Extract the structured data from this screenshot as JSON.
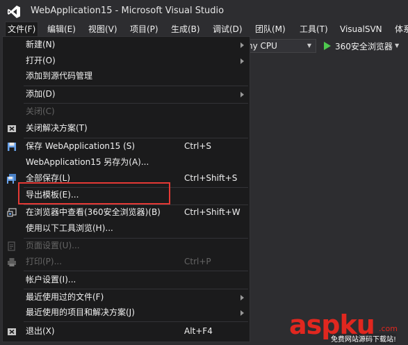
{
  "window": {
    "title": "WebApplication15 - Microsoft Visual Studio"
  },
  "menubar": {
    "items": [
      "文件(F)",
      "编辑(E)",
      "视图(V)",
      "项目(P)",
      "生成(B)",
      "调试(D)",
      "团队(M)",
      "工具(T)",
      "VisualSVN",
      "体系"
    ]
  },
  "toolbar": {
    "cpu": "ny CPU",
    "browser": "360安全浏览器"
  },
  "file_menu": {
    "items": [
      {
        "label": "新建(N)",
        "shortcut": "",
        "submenu": true,
        "disabled": false,
        "icon": ""
      },
      {
        "label": "打开(O)",
        "shortcut": "",
        "submenu": true,
        "disabled": false,
        "icon": ""
      },
      {
        "label": "添加到源代码管理",
        "shortcut": "",
        "submenu": false,
        "disabled": false,
        "icon": ""
      },
      {
        "label": "添加(D)",
        "shortcut": "",
        "submenu": true,
        "disabled": false,
        "icon": ""
      },
      {
        "label": "关闭(C)",
        "shortcut": "",
        "submenu": false,
        "disabled": true,
        "icon": ""
      },
      {
        "label": "关闭解决方案(T)",
        "shortcut": "",
        "submenu": false,
        "disabled": false,
        "icon": "close-solution-icon"
      },
      {
        "label": "保存 WebApplication15 (S)",
        "shortcut": "Ctrl+S",
        "submenu": false,
        "disabled": false,
        "icon": "save-icon"
      },
      {
        "label": "WebApplication15 另存为(A)...",
        "shortcut": "",
        "submenu": false,
        "disabled": false,
        "icon": ""
      },
      {
        "label": "全部保存(L)",
        "shortcut": "Ctrl+Shift+S",
        "submenu": false,
        "disabled": false,
        "icon": "save-all-icon"
      },
      {
        "label": "导出模板(E)...",
        "shortcut": "",
        "submenu": false,
        "disabled": false,
        "icon": ""
      },
      {
        "label": "在浏览器中查看(360安全浏览器)(B)",
        "shortcut": "Ctrl+Shift+W",
        "submenu": false,
        "disabled": false,
        "icon": "view-in-browser-icon"
      },
      {
        "label": "使用以下工具浏览(H)...",
        "shortcut": "",
        "submenu": false,
        "disabled": false,
        "icon": ""
      },
      {
        "label": "页面设置(U)...",
        "shortcut": "",
        "submenu": false,
        "disabled": true,
        "icon": "page-setup-icon"
      },
      {
        "label": "打印(P)...",
        "shortcut": "Ctrl+P",
        "submenu": false,
        "disabled": true,
        "icon": "print-icon"
      },
      {
        "label": "帐户设置(I)...",
        "shortcut": "",
        "submenu": false,
        "disabled": false,
        "icon": ""
      },
      {
        "label": "最近使用过的文件(F)",
        "shortcut": "",
        "submenu": true,
        "disabled": false,
        "icon": ""
      },
      {
        "label": "最近使用的项目和解决方案(J)",
        "shortcut": "",
        "submenu": true,
        "disabled": false,
        "icon": ""
      },
      {
        "label": "退出(X)",
        "shortcut": "Alt+F4",
        "submenu": false,
        "disabled": false,
        "icon": "exit-icon"
      }
    ]
  },
  "watermark": {
    "brand": "aspku",
    "domain": ".com",
    "tagline": "免费网站源码下载站!"
  },
  "colors": {
    "accent": "#e53935",
    "menu_bg": "#1b1b1c",
    "chrome_bg": "#2d2d30",
    "run_green": "#4ec94e"
  }
}
